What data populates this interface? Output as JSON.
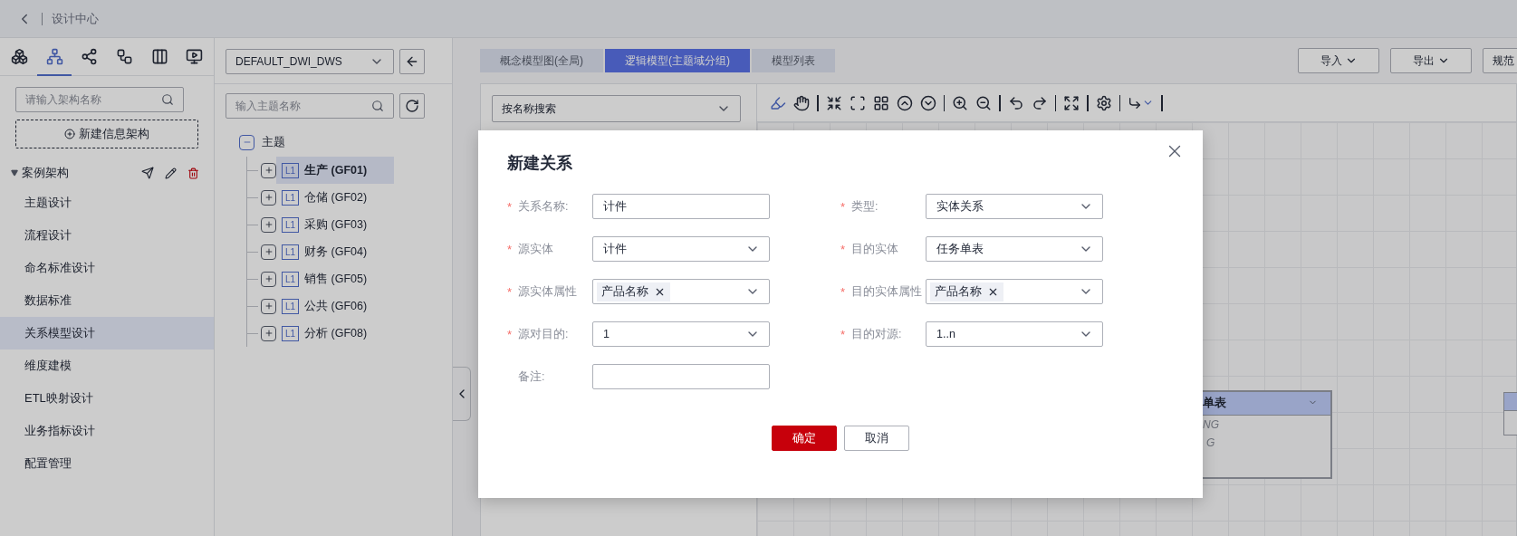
{
  "header": {
    "title": "设计中心"
  },
  "sidebar": {
    "icon_tabs": [
      {
        "selected": false
      },
      {
        "selected": true
      },
      {
        "selected": false
      },
      {
        "selected": false
      },
      {
        "selected": false
      },
      {
        "selected": false
      }
    ],
    "search": {
      "placeholder": "请输入架构名称"
    },
    "new_button": "新建信息架构",
    "group": {
      "label": "案例架构",
      "expanded": true
    },
    "items": [
      {
        "label": "主题设计",
        "selected": false
      },
      {
        "label": "流程设计",
        "selected": false
      },
      {
        "label": "命名标准设计",
        "selected": false
      },
      {
        "label": "数据标准",
        "selected": false
      },
      {
        "label": "关系模型设计",
        "selected": true
      },
      {
        "label": "维度建模",
        "selected": false
      },
      {
        "label": "ETL映射设计",
        "selected": false
      },
      {
        "label": "业务指标设计",
        "selected": false
      },
      {
        "label": "配置管理",
        "selected": false
      }
    ]
  },
  "tree_panel": {
    "workspace": "DEFAULT_DWI_DWS",
    "search": {
      "placeholder": "输入主题名称"
    },
    "root": {
      "label": "主题",
      "expanded": true,
      "children": [
        {
          "badge": "L1",
          "label": "生产 (GF01)",
          "selected": true,
          "expanded": false
        },
        {
          "badge": "L1",
          "label": "仓储 (GF02)",
          "selected": false,
          "expanded": false
        },
        {
          "badge": "L1",
          "label": "采购 (GF03)",
          "selected": false,
          "expanded": false
        },
        {
          "badge": "L1",
          "label": "财务 (GF04)",
          "selected": false,
          "expanded": false
        },
        {
          "badge": "L1",
          "label": "销售 (GF05)",
          "selected": false,
          "expanded": false
        },
        {
          "badge": "L1",
          "label": "公共 (GF06)",
          "selected": false,
          "expanded": false
        },
        {
          "badge": "L1",
          "label": "分析 (GF08)",
          "selected": false,
          "expanded": false
        }
      ]
    }
  },
  "main": {
    "tabs": [
      {
        "label": "概念模型图(全局)",
        "selected": false
      },
      {
        "label": "逻辑模型(主题域分组)",
        "selected": true
      },
      {
        "label": "模型列表",
        "selected": false
      }
    ],
    "actions": [
      {
        "label": "导入",
        "has_menu": true
      },
      {
        "label": "导出",
        "has_menu": true
      },
      {
        "label": "规范",
        "has_menu": false
      }
    ],
    "search_select": "按名称搜索",
    "canvas": {
      "node": {
        "title": "单表",
        "rows": [
          "NG",
          "G"
        ]
      }
    }
  },
  "dialog": {
    "title": "新建关系",
    "fields": [
      {
        "marker": "*",
        "label": "关系名称:",
        "kind": "text",
        "value": "计件"
      },
      {
        "marker": "*",
        "label": "类型:",
        "kind": "select",
        "value": "实体关系"
      },
      {
        "marker": "*",
        "label": "源实体",
        "kind": "select",
        "value": "计件"
      },
      {
        "marker": "*",
        "label": "目的实体",
        "kind": "select",
        "value": "任务单表"
      },
      {
        "marker": "*",
        "label": "源实体属性",
        "kind": "tags",
        "tags": [
          "产品名称"
        ]
      },
      {
        "marker": "*",
        "label": "目的实体属性",
        "kind": "tags",
        "tags": [
          "产品名称"
        ]
      },
      {
        "marker": "*",
        "label": "源对目的:",
        "kind": "select",
        "value": "1"
      },
      {
        "marker": "*",
        "label": "目的对源:",
        "kind": "select",
        "value": "1..n"
      },
      {
        "label": "备注:",
        "kind": "text"
      }
    ],
    "buttons": [
      {
        "label": "确定",
        "primary": true
      },
      {
        "label": "取消",
        "primary": false
      }
    ]
  }
}
